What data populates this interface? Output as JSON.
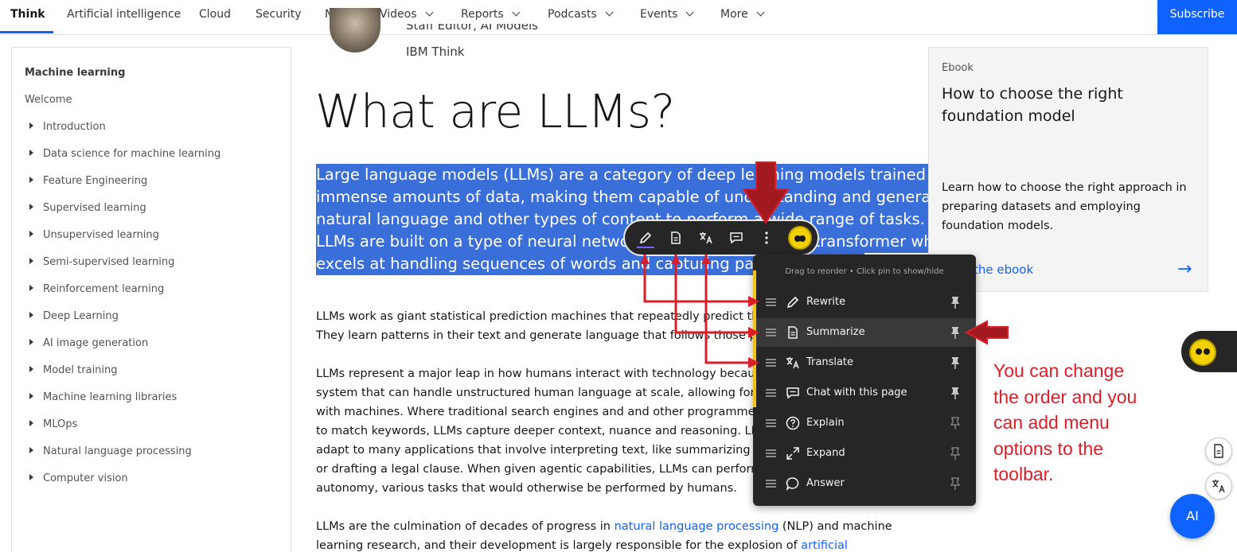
{
  "nav": {
    "brand": "Think",
    "items": [
      "Artificial intelligence",
      "Cloud",
      "Security",
      "News",
      "Videos",
      "Reports",
      "Podcasts",
      "Events",
      "More"
    ],
    "subscribe": "Subscribe"
  },
  "sidebar": {
    "heading": "Machine learning",
    "welcome": "Welcome",
    "items": [
      "Introduction",
      "Data science for machine learning",
      "Feature Engineering",
      "Supervised learning",
      "Unsupervised learning",
      "Semi-supervised learning",
      "Reinforcement learning",
      "Deep Learning",
      "AI image generation",
      "Model training",
      "Machine learning libraries",
      "MLOps",
      "Natural language processing",
      "Computer vision"
    ]
  },
  "author": {
    "role": "Staff Editor, AI Models",
    "org": "IBM Think"
  },
  "article": {
    "title": "What are LLMs?",
    "highlight_lines": [
      "Large language models (LLMs) are a category of deep learning models trained on",
      "immense amounts of data, making them capable of understanding and generating",
      "natural language and other types of content to perform a wide range of tasks.",
      "LLMs are built on a type of neural network architecture called a transformer which",
      "excels at handling sequences of words and capturing patterns in text."
    ],
    "p1": [
      "LLMs work as giant statistical prediction machines that repeatedly predict the next word in a sequence.",
      "They learn patterns in their text and generate language that follows those patterns."
    ],
    "p2": [
      "LLMs represent a major leap in how humans interact with technology because they are the first AI",
      "system that can handle unstructured human language at scale, allowing for natural communication",
      "with machines. Where traditional search engines and and other programmed systems used algorithms",
      "to match keywords, LLMs capture deeper context, nuance and reasoning. LLMs, once trained, can",
      "adapt to many applications that involve interpreting text, like summarizing an article, debugging code",
      "or drafting a legal clause. When given agentic capabilities, LLMs can perform, with varying degrees of",
      "autonomy, various tasks that would otherwise be performed by humans."
    ],
    "p3": {
      "l1_a": "LLMs are the culmination of decades of progress in ",
      "l1_link": "natural language processing",
      "l1_b": " (NLP) and machine",
      "l2_a": "learning research, and their development is largely responsible for the explosion of ",
      "l2_link": "artificial"
    }
  },
  "ebook": {
    "tag": "Ebook",
    "title": "How to choose the right foundation model",
    "description": "Learn how to choose the right approach in preparing datasets and employing foundation models.",
    "link": "the ebook",
    "arrow": "→"
  },
  "toolbar": {
    "buttons": [
      "rewrite",
      "summarize",
      "translate",
      "chat",
      "more"
    ]
  },
  "menu": {
    "hint": "Drag to reorder • Click pin to show/hide",
    "items": [
      {
        "label": "Rewrite",
        "icon": "pencil-icon",
        "pinned": true
      },
      {
        "label": "Summarize",
        "icon": "document-icon",
        "pinned": true
      },
      {
        "label": "Translate",
        "icon": "translate-icon",
        "pinned": true
      },
      {
        "label": "Chat with this page",
        "icon": "chat-icon",
        "pinned": true
      },
      {
        "label": "Explain",
        "icon": "help-circle-icon",
        "pinned": false
      },
      {
        "label": "Expand",
        "icon": "expand-icon",
        "pinned": false
      },
      {
        "label": "Answer",
        "icon": "speech-bubble-icon",
        "pinned": false
      }
    ]
  },
  "annotation": {
    "text": "You can change the order and you can add menu options to the toolbar.",
    "color": "#da1e28"
  },
  "fab": {
    "label": "AI"
  },
  "colors": {
    "accent": "#0f62fe",
    "highlight": "#3a6ed8",
    "menu_bg": "#262626",
    "annotation_red": "#da1e28"
  }
}
